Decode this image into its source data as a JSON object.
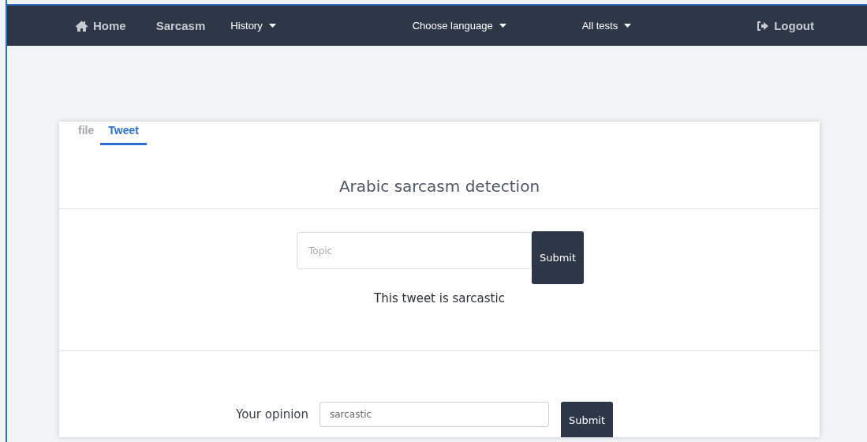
{
  "navbar": {
    "items": [
      {
        "label": "Home",
        "kind": "icon_link"
      },
      {
        "label": "Sarcasm",
        "kind": "link"
      },
      {
        "label": "History",
        "kind": "dropdown"
      },
      {
        "label": "Choose language",
        "kind": "dropdown"
      },
      {
        "label": "All tests",
        "kind": "dropdown"
      },
      {
        "label": "Logout",
        "kind": "icon_link"
      }
    ]
  },
  "tabs": [
    {
      "label": "file",
      "selected": false
    },
    {
      "label": "Tweet",
      "selected": true
    }
  ],
  "title": "Arabic sarcasm detection",
  "topic_form": {
    "placeholder": "Topic",
    "button": "Submit"
  },
  "result": "This tweet is sarcastic",
  "opinion_form": {
    "label": "Your opinion",
    "value": "sarcastic",
    "button": "Submit"
  }
}
